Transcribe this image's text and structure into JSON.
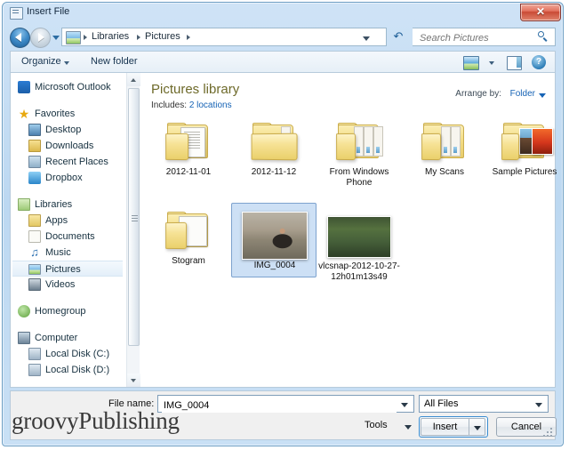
{
  "window": {
    "title": "Insert File",
    "title_icon": "file-dialog-icon",
    "close_label": "✕"
  },
  "nav": {
    "back_icon": "back-arrow-icon",
    "forward_icon": "forward-arrow-icon",
    "history_dropdown_icon": "chevron-down-icon",
    "breadcrumb_icon": "pictures-library-icon",
    "breadcrumbs": [
      "Libraries",
      "Pictures"
    ],
    "refresh_icon": "refresh-icon",
    "search_placeholder": "Search Pictures",
    "search_value": "",
    "search_icon": "search-icon"
  },
  "toolbar": {
    "organize_label": "Organize",
    "new_folder_label": "New folder",
    "view_icon": "change-view-icon",
    "view_caret_icon": "chevron-down-icon",
    "preview_pane_icon": "preview-pane-icon",
    "help_icon": "help-icon",
    "help_glyph": "?"
  },
  "sidebar": {
    "items": [
      {
        "label": "Microsoft Outlook",
        "icon": "outlook-icon",
        "level": 0,
        "selected": false
      },
      {
        "label": "Favorites",
        "icon": "favorites-star-icon",
        "level": 0,
        "selected": false
      },
      {
        "label": "Desktop",
        "icon": "desktop-icon",
        "level": 1,
        "selected": false
      },
      {
        "label": "Downloads",
        "icon": "downloads-icon",
        "level": 1,
        "selected": false
      },
      {
        "label": "Recent Places",
        "icon": "recent-places-icon",
        "level": 1,
        "selected": false
      },
      {
        "label": "Dropbox",
        "icon": "dropbox-icon",
        "level": 1,
        "selected": false
      },
      {
        "label": "Libraries",
        "icon": "libraries-icon",
        "level": 0,
        "selected": false
      },
      {
        "label": "Apps",
        "icon": "folder-icon",
        "level": 1,
        "selected": false
      },
      {
        "label": "Documents",
        "icon": "documents-icon",
        "level": 1,
        "selected": false
      },
      {
        "label": "Music",
        "icon": "music-icon",
        "level": 1,
        "selected": false
      },
      {
        "label": "Pictures",
        "icon": "pictures-icon",
        "level": 1,
        "selected": true
      },
      {
        "label": "Videos",
        "icon": "videos-icon",
        "level": 1,
        "selected": false
      },
      {
        "label": "Homegroup",
        "icon": "homegroup-icon",
        "level": 0,
        "selected": false
      },
      {
        "label": "Computer",
        "icon": "computer-icon",
        "level": 0,
        "selected": false
      },
      {
        "label": "Local Disk (C:)",
        "icon": "local-disk-icon",
        "level": 1,
        "selected": false
      },
      {
        "label": "Local Disk (D:)",
        "icon": "local-disk-icon",
        "level": 1,
        "selected": false
      }
    ],
    "scroll_up_icon": "scroll-up-arrow-icon",
    "scroll_down_icon": "scroll-down-arrow-icon"
  },
  "library": {
    "title": "Pictures library",
    "includes_label": "Includes:",
    "locations_link": "2 locations",
    "arrange_label": "Arrange by:",
    "arrange_value": "Folder",
    "arrange_caret_icon": "chevron-down-icon"
  },
  "files": [
    {
      "name": "2012-11-01",
      "type": "folder",
      "variant": "document",
      "selected": false
    },
    {
      "name": "2012-11-12",
      "type": "folder",
      "variant": "sheet",
      "selected": false
    },
    {
      "name": "From Windows Phone",
      "type": "folder",
      "variant": "multi",
      "selected": false
    },
    {
      "name": "My Scans",
      "type": "folder",
      "variant": "multi",
      "selected": false
    },
    {
      "name": "Sample Pictures",
      "type": "folder",
      "variant": "photos",
      "selected": false
    },
    {
      "name": "Stogram",
      "type": "folder",
      "variant": "document",
      "selected": false
    },
    {
      "name": "IMG_0004",
      "type": "image",
      "variant": "street-photo",
      "selected": true
    },
    {
      "name": "vlcsnap-2012-10-27-12h01m13s49",
      "type": "image",
      "variant": "forest-photo",
      "selected": false
    }
  ],
  "footer": {
    "file_name_label": "File name:",
    "file_name_value": "IMG_0004",
    "file_name_caret_icon": "chevron-down-icon",
    "filter_value": "All Files",
    "filter_caret_icon": "chevron-down-icon",
    "tools_label": "Tools",
    "tools_caret_icon": "chevron-down-icon",
    "insert_label": "Insert",
    "insert_split_icon": "chevron-down-icon",
    "cancel_label": "Cancel",
    "resizer_icon": "resize-grip-icon"
  },
  "watermark": "groovyPublishing",
  "colors": {
    "accent": "#1663b5",
    "library_title": "#6e6a2a",
    "selection": "#cde0f5",
    "close_button": "#c94a34"
  }
}
